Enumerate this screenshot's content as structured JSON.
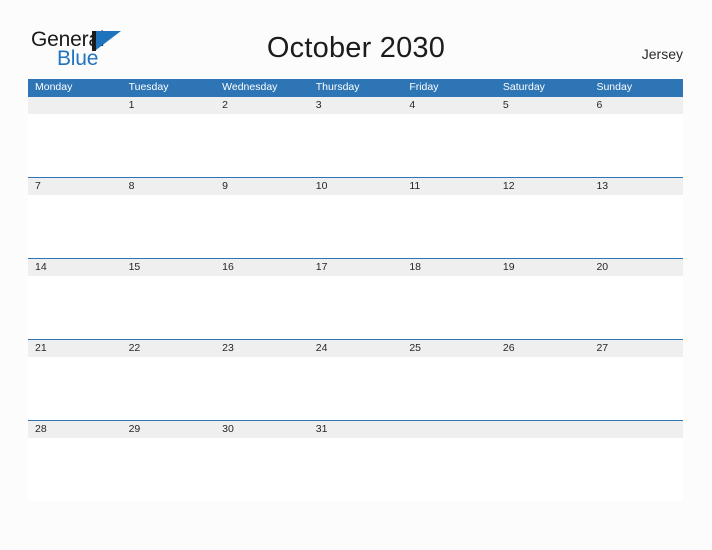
{
  "header": {
    "logo": {
      "text_primary": "General",
      "text_secondary": "Blue",
      "primary_color": "#1a1a1a",
      "secondary_color": "#2074c0",
      "flag_color": "#1f73bd"
    },
    "title": "October 2030",
    "location": "Jersey"
  },
  "calendar": {
    "header_background": "#2e75b6",
    "header_text_color": "#ffffff",
    "band_background": "#efefef",
    "band_border_color": "#2e75b6",
    "weekdays": [
      "Monday",
      "Tuesday",
      "Wednesday",
      "Thursday",
      "Friday",
      "Saturday",
      "Sunday"
    ],
    "weeks": [
      [
        "",
        "1",
        "2",
        "3",
        "4",
        "5",
        "6"
      ],
      [
        "7",
        "8",
        "9",
        "10",
        "11",
        "12",
        "13"
      ],
      [
        "14",
        "15",
        "16",
        "17",
        "18",
        "19",
        "20"
      ],
      [
        "21",
        "22",
        "23",
        "24",
        "25",
        "26",
        "27"
      ],
      [
        "28",
        "29",
        "30",
        "31",
        "",
        "",
        ""
      ]
    ]
  }
}
